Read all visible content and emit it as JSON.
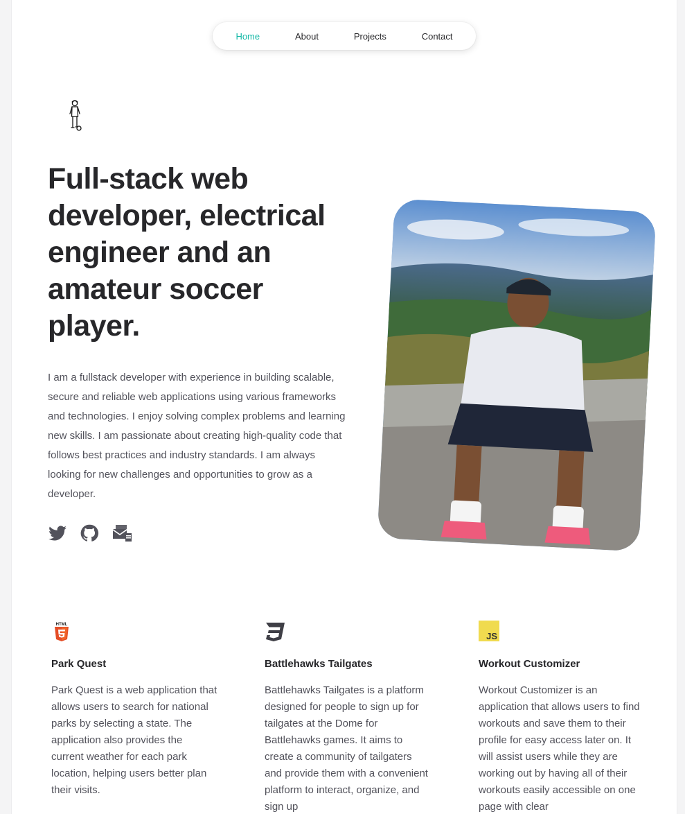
{
  "nav": {
    "items": [
      {
        "label": "Home",
        "active": true
      },
      {
        "label": "About",
        "active": false
      },
      {
        "label": "Projects",
        "active": false
      },
      {
        "label": "Contact",
        "active": false
      }
    ],
    "active_color": "#14b8a6"
  },
  "hero": {
    "headline": "Full-stack web developer, electrical engineer and an amateur soccer player.",
    "intro": "I am a fullstack developer with experience in building scalable, secure and reliable web applications using various frameworks and technologies. I enjoy solving complex problems and learning new skills. I am passionate about creating high-quality code that follows best practices and industry standards. I am always looking for new challenges and opportunities to grow as a developer.",
    "social_icons": [
      "twitter-icon",
      "github-icon",
      "mail-icon"
    ]
  },
  "projects": [
    {
      "icon": "html5-icon",
      "title": "Park Quest",
      "description": "Park Quest is a web application that allows users to search for national parks by selecting a state. The application also provides the current weather for each park location, helping users better plan their visits."
    },
    {
      "icon": "css3-icon",
      "title": "Battlehawks Tailgates",
      "description": "Battlehawks Tailgates is a platform designed for people to sign up for tailgates at the Dome for Battlehawks games. It aims to create a community of tailgaters and provide them with a convenient platform to interact, organize, and sign up"
    },
    {
      "icon": "javascript-icon",
      "logo_text": "JS",
      "title": "Workout Customizer",
      "description": "Workout Customizer is an application that allows users to find workouts and save them to their profile for easy access later on. It will assist users while they are working out by having all of their workouts easily accessible on one page with clear"
    }
  ],
  "colors": {
    "html5": "#e44d26",
    "css3": "#3f3f46",
    "javascript": "#f0db4f"
  }
}
